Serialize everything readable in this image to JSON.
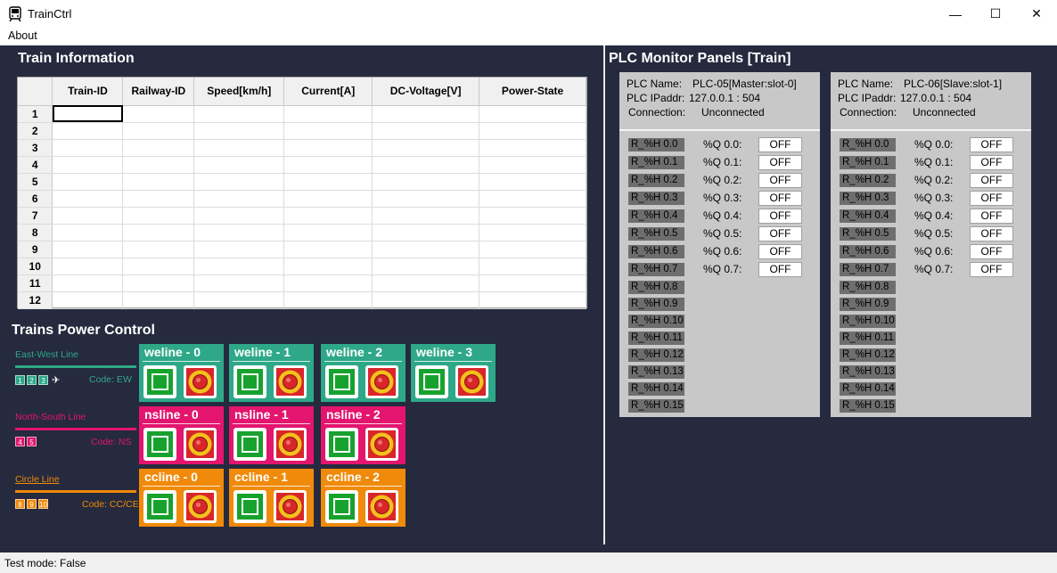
{
  "window": {
    "title": "TrainCtrl",
    "minimize": "—",
    "maximize": "☐",
    "close": "✕"
  },
  "menu": {
    "about": "About"
  },
  "status": {
    "text": "Test mode: False"
  },
  "train_info": {
    "title": "Train Information",
    "columns": [
      "Train-ID",
      "Railway-ID",
      "Speed[km/h]",
      "Current[A]",
      "DC-Voltage[V]",
      "Power-State"
    ],
    "rows": [
      "1",
      "2",
      "3",
      "4",
      "5",
      "6",
      "7",
      "8",
      "9",
      "10",
      "11",
      "12"
    ]
  },
  "power_control": {
    "title": "Trains Power Control",
    "lines": [
      {
        "name": "East-West Line",
        "code_label": "Code: EW",
        "badges": [
          "1",
          "2",
          "3"
        ],
        "color": "#2ea888",
        "has_plane": true,
        "tiles": [
          "weline - 0",
          "weline - 1",
          "weline - 2",
          "weline - 3"
        ]
      },
      {
        "name": "North-South Line",
        "code_label": "Code: NS",
        "badges": [
          "4",
          "5"
        ],
        "color": "#e3156e",
        "has_plane": false,
        "tiles": [
          "nsline - 0",
          "nsline - 1",
          "nsline - 2"
        ]
      },
      {
        "name": "Circle Line",
        "code_label": "Code: CC/CE",
        "badges": [
          "8",
          "9",
          "10"
        ],
        "color": "#f08a0a",
        "has_plane": false,
        "tiles": [
          "ccline - 0",
          "ccline - 1",
          "ccline - 2"
        ]
      }
    ]
  },
  "plc_monitor": {
    "title": "PLC Monitor Panels [Train]",
    "panels": [
      {
        "name_label": "PLC Name:",
        "name": "PLC-05[Master:slot-0]",
        "ip_label": "PLC IPaddr:",
        "ip": "127.0.0.1 : 504",
        "conn_label": "Connection:",
        "conn": "Unconnected"
      },
      {
        "name_label": "PLC Name:",
        "name": "PLC-06[Slave:slot-1]",
        "ip_label": "PLC IPaddr:",
        "ip": "127.0.0.1 : 504",
        "conn_label": "Connection:",
        "conn": "Unconnected"
      }
    ],
    "registers": [
      "R_%H 0.0",
      "R_%H 0.1",
      "R_%H 0.2",
      "R_%H 0.3",
      "R_%H 0.4",
      "R_%H 0.5",
      "R_%H 0.6",
      "R_%H 0.7",
      "R_%H 0.8",
      "R_%H 0.9",
      "R_%H 0.10",
      "R_%H 0.11",
      "R_%H 0.12",
      "R_%H 0.13",
      "R_%H 0.14",
      "R_%H 0.15"
    ],
    "outputs": [
      "%Q 0.0:",
      "%Q 0.1:",
      "%Q 0.2:",
      "%Q 0.3:",
      "%Q 0.4:",
      "%Q 0.5:",
      "%Q 0.6:",
      "%Q 0.7:"
    ],
    "output_state": "OFF"
  }
}
